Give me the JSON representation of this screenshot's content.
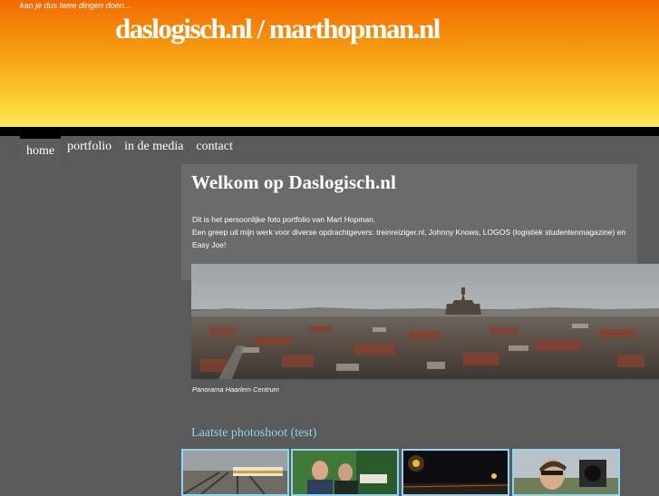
{
  "header": {
    "tagline": "kan je dus twee dingen doen...",
    "site_title": "daslogisch.nl / marthopman.nl"
  },
  "nav": {
    "items": [
      {
        "label": "home",
        "active": true
      },
      {
        "label": "portfolio",
        "active": false
      },
      {
        "label": "in de media",
        "active": false
      },
      {
        "label": "contact",
        "active": false
      }
    ]
  },
  "main": {
    "title": "Welkom op Daslogisch.nl",
    "intro_line1": "Dit is het persoonlijke foto portfolio van Mart Hopman.",
    "intro_line2": "Een greep uit mijn werk voor diverse opdrachtgevers: treinreiziger.nl, Johnny Knows, LOGOS (logistiek studentenmagazine) en Easy Joe!",
    "panorama_caption": "Panorama Haarlem Centrum"
  },
  "photoshoot": {
    "title": "Laatste photoshoot (test)",
    "thumbnails": [
      "railway-photo",
      "event-photo",
      "night-photo",
      "portrait-photo"
    ]
  },
  "colors": {
    "header_top": "#f26a00",
    "header_bottom": "#fde660",
    "page_background": "#5a5a5a",
    "panel_background": "#6b6b6b",
    "accent_border": "#8fd4f0"
  }
}
